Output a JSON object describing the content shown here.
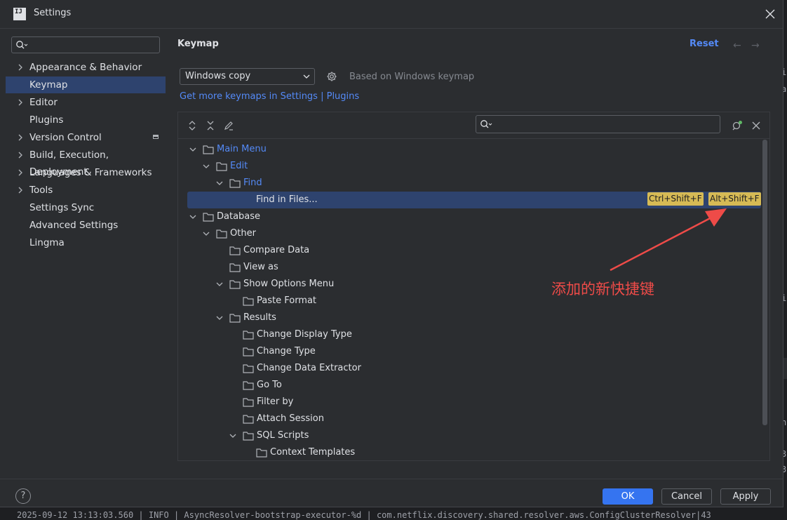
{
  "window": {
    "title": "Settings"
  },
  "sidebar": {
    "search_placeholder": "",
    "items": [
      {
        "label": "Appearance & Behavior",
        "expandable": true
      },
      {
        "label": "Keymap",
        "expandable": false,
        "selected": true
      },
      {
        "label": "Editor",
        "expandable": true
      },
      {
        "label": "Plugins",
        "expandable": false
      },
      {
        "label": "Version Control",
        "expandable": true
      },
      {
        "label": "Build, Execution, Deployment",
        "expandable": true
      },
      {
        "label": "Languages & Frameworks",
        "expandable": true
      },
      {
        "label": "Tools",
        "expandable": true
      },
      {
        "label": "Settings Sync",
        "expandable": false
      },
      {
        "label": "Advanced Settings",
        "expandable": false
      },
      {
        "label": "Lingma",
        "expandable": false
      }
    ]
  },
  "content": {
    "heading": "Keymap",
    "reset_label": "Reset",
    "back_icon": "←",
    "forward_icon": "→",
    "keymap_select": "Windows copy",
    "based_on": "Based on Windows keymap",
    "more_link": "Get more keymaps in Settings | Plugins",
    "filter_placeholder": ""
  },
  "tree": [
    {
      "label": "Main Menu",
      "blue": true
    },
    {
      "label": "Edit",
      "blue": true
    },
    {
      "label": "Find",
      "blue": true
    },
    {
      "label": "Find in Files...",
      "shortcuts": [
        "Ctrl+Shift+F",
        "Alt+Shift+F"
      ]
    },
    {
      "label": "Database"
    },
    {
      "label": "Other"
    },
    {
      "label": "Compare Data"
    },
    {
      "label": "View as"
    },
    {
      "label": "Show Options Menu"
    },
    {
      "label": "Paste Format"
    },
    {
      "label": "Results"
    },
    {
      "label": "Change Display Type"
    },
    {
      "label": "Change Type"
    },
    {
      "label": "Change Data Extractor"
    },
    {
      "label": "Go To"
    },
    {
      "label": "Filter by"
    },
    {
      "label": "Attach Session"
    },
    {
      "label": "SQL Scripts"
    },
    {
      "label": "Context Templates"
    }
  ],
  "annotation": {
    "text": "添加的新快捷键",
    "color": "#ee4b48"
  },
  "buttons": {
    "help": "?",
    "ok": "OK",
    "cancel": "Cancel",
    "apply": "Apply"
  },
  "background": {
    "log_line": "2025-09-12 13:13:03.560 | INFO | AsyncResolver-bootstrap-executor-%d | com.netflix.discovery.shared.resolver.aws.ConfigClusterResolver|43"
  },
  "colors": {
    "accent": "#548af7",
    "selection": "#2e436e",
    "shortcut_highlight": "#d6ba55",
    "primary_button": "#3574f0"
  }
}
